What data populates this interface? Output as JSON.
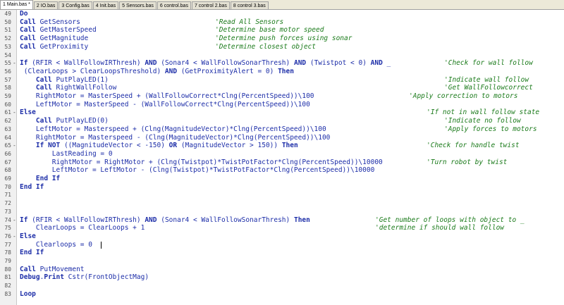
{
  "tabs": [
    {
      "label": "1 Main.bas *",
      "active": true
    },
    {
      "label": "2 IO.bas"
    },
    {
      "label": "3 Config.bas"
    },
    {
      "label": "4 Init.bas"
    },
    {
      "label": "5 Sensors.bas"
    },
    {
      "label": "6 control.bas"
    },
    {
      "label": "7 control 2.bas"
    },
    {
      "label": "8 control 3.bas"
    }
  ],
  "lines": [
    {
      "n": "49",
      "code": [
        {
          "k": "kw",
          "t": "Do"
        }
      ]
    },
    {
      "n": "50",
      "code": [
        {
          "k": "kw",
          "t": "Call"
        },
        {
          "t": " GetSensors"
        }
      ],
      "comment": "'Read All Sensors"
    },
    {
      "n": "51",
      "code": [
        {
          "k": "kw",
          "t": "Call"
        },
        {
          "t": " GetMasterSpeed"
        }
      ],
      "comment": "'Determine base motor speed"
    },
    {
      "n": "52",
      "code": [
        {
          "k": "kw",
          "t": "Call"
        },
        {
          "t": " GetMagnitude"
        }
      ],
      "comment": "'Determine push forces using sonar"
    },
    {
      "n": "53",
      "code": [
        {
          "k": "kw",
          "t": "Call"
        },
        {
          "t": " GetProximity"
        }
      ],
      "comment": "'Determine closest object"
    },
    {
      "n": "54",
      "code": []
    },
    {
      "n": "55",
      "fold": "-",
      "code": [
        {
          "k": "kw",
          "t": "If"
        },
        {
          "t": " (RFIR < WallFollowIRThresh) "
        },
        {
          "k": "kw",
          "t": "AND"
        },
        {
          "t": " (Sonar4 < WallFollowSonarThresh) "
        },
        {
          "k": "kw",
          "t": "AND"
        },
        {
          "t": " (Twistpot < 0) "
        },
        {
          "k": "kw",
          "t": "AND"
        },
        {
          "t": " _"
        }
      ],
      "comment": "'Check for wall follow"
    },
    {
      "n": "56",
      "code": [
        {
          "t": " (ClearLoops > ClearLoopsThreshold) "
        },
        {
          "k": "kw",
          "t": "AND"
        },
        {
          "t": " (GetProximityAlert = 0) "
        },
        {
          "k": "kw",
          "t": "Then"
        }
      ]
    },
    {
      "n": "57",
      "code": [
        {
          "t": "    "
        },
        {
          "k": "kw",
          "t": "Call"
        },
        {
          "t": " PutPlayLED(1)"
        }
      ],
      "comment": "'Indicate wall follow"
    },
    {
      "n": "58",
      "code": [
        {
          "t": "    "
        },
        {
          "k": "kw",
          "t": "Call"
        },
        {
          "t": " RightWallFollow"
        }
      ],
      "comment": "'Get WallFollowcorrect"
    },
    {
      "n": "59",
      "code": [
        {
          "t": "    RightMotor = MasterSpeed + (WallFollowCorrect*Clng(PercentSpeed))\\100"
        }
      ],
      "comment": "'Apply correction to motors"
    },
    {
      "n": "60",
      "code": [
        {
          "t": "    LeftMotor = MasterSpeed - (WallFollowCorrect*Clng(PercentSpeed))\\100"
        }
      ]
    },
    {
      "n": "61",
      "fold": "-",
      "code": [
        {
          "k": "kw",
          "t": "Else"
        }
      ],
      "comment": "'If not in wall follow state"
    },
    {
      "n": "62",
      "code": [
        {
          "t": "    "
        },
        {
          "k": "kw",
          "t": "Call"
        },
        {
          "t": " PutPlayLED(0)"
        }
      ],
      "comment": "'Indicate no follow"
    },
    {
      "n": "63",
      "code": [
        {
          "t": "    LeftMotor = Masterspeed + (Clng(MagnitudeVector)*Clng(PercentSpeed))\\100"
        }
      ],
      "comment": "'Apply forces to motors"
    },
    {
      "n": "64",
      "code": [
        {
          "t": "    RightMotor = Masterspeed - (Clng(MagnitudeVector)*Clng(PercentSpeed))\\100"
        }
      ]
    },
    {
      "n": "65",
      "fold": "-",
      "code": [
        {
          "t": "    "
        },
        {
          "k": "kw",
          "t": "If NOT"
        },
        {
          "t": " ((MagnitudeVector < -150) "
        },
        {
          "k": "kw",
          "t": "OR"
        },
        {
          "t": " (MagnitudeVector > 150)) "
        },
        {
          "k": "kw",
          "t": "Then"
        }
      ],
      "comment": "'Check for handle twist"
    },
    {
      "n": "66",
      "code": [
        {
          "t": "        LastReading = 0"
        }
      ]
    },
    {
      "n": "67",
      "code": [
        {
          "t": "        RightMotor = RightMotor + (Clng(Twistpot)*TwistPotFactor*Clng(PercentSpeed))\\10000"
        }
      ],
      "comment": "'Turn robot by twist"
    },
    {
      "n": "68",
      "code": [
        {
          "t": "        LeftMotor = LeftMotor - (Clng(Twistpot)*TwistPotFactor*Clng(PercentSpeed))\\10000"
        }
      ]
    },
    {
      "n": "69",
      "code": [
        {
          "t": "    "
        },
        {
          "k": "kw",
          "t": "End If"
        }
      ]
    },
    {
      "n": "70",
      "code": [
        {
          "k": "kw",
          "t": "End If"
        }
      ]
    },
    {
      "n": "71",
      "code": []
    },
    {
      "n": "72",
      "code": []
    },
    {
      "n": "73",
      "code": []
    },
    {
      "n": "74",
      "fold": "-",
      "code": [
        {
          "k": "kw",
          "t": "If"
        },
        {
          "t": " (RFIR < WallFollowIRThresh) "
        },
        {
          "k": "kw",
          "t": "AND"
        },
        {
          "t": " (Sonar4 < WallFollowSonarThresh) "
        },
        {
          "k": "kw",
          "t": "Then"
        }
      ],
      "comment": "'Get number of loops with object to _"
    },
    {
      "n": "75",
      "code": [
        {
          "t": "    ClearLoops = ClearLoops + 1"
        }
      ],
      "comment": "'determine if should wall follow"
    },
    {
      "n": "76",
      "fold": "-",
      "code": [
        {
          "k": "kw",
          "t": "Else"
        }
      ]
    },
    {
      "n": "77",
      "code": [
        {
          "t": "    Clearloops = 0"
        }
      ]
    },
    {
      "n": "78",
      "code": [
        {
          "k": "kw",
          "t": "End If"
        }
      ]
    },
    {
      "n": "79",
      "code": []
    },
    {
      "n": "80",
      "code": [
        {
          "k": "kw",
          "t": "Call"
        },
        {
          "t": " PutMovement"
        }
      ]
    },
    {
      "n": "81",
      "code": [
        {
          "k": "kw",
          "t": "Debug"
        },
        {
          "t": "."
        },
        {
          "k": "kw",
          "t": "Print"
        },
        {
          "t": " Cstr(FrontObjectMag)"
        }
      ]
    },
    {
      "n": "82",
      "code": []
    },
    {
      "n": "83",
      "code": [
        {
          "k": "kw",
          "t": "Loop"
        }
      ]
    }
  ]
}
